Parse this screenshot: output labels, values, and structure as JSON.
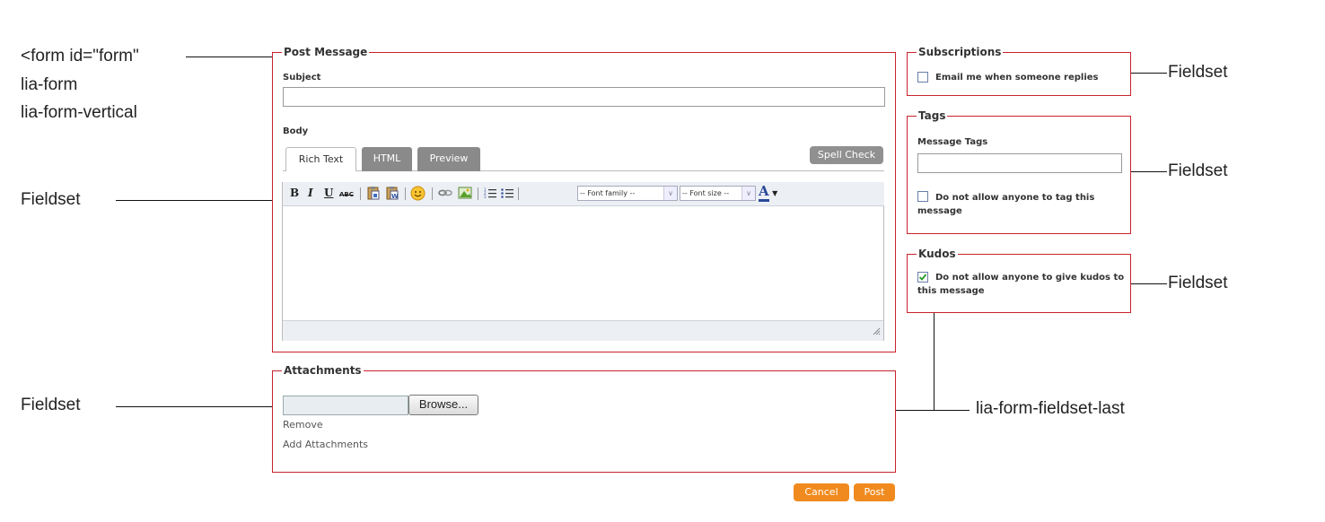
{
  "annotations": {
    "form_line1": "<form id=\"form\"",
    "form_line2": "lia-form",
    "form_line3": "lia-form-vertical",
    "fieldset_left_1": "Fieldset",
    "fieldset_left_2": "Fieldset",
    "fieldset_right_1": "Fieldset",
    "fieldset_right_2": "Fieldset",
    "fieldset_right_3": "Fieldset",
    "last_fieldset": "lia-form-fieldset-last"
  },
  "post_message": {
    "legend": "Post Message",
    "subject_label": "Subject",
    "subject_value": "",
    "body_label": "Body",
    "tabs": [
      {
        "label": "Rich Text",
        "active": true
      },
      {
        "label": "HTML",
        "active": false
      },
      {
        "label": "Preview",
        "active": false
      }
    ],
    "spell_check": "Spell Check",
    "toolbar": {
      "bold": "B",
      "italic": "I",
      "underline": "U",
      "strike": "ABC",
      "font_family": "-- Font family --",
      "font_size": "-- Font size --",
      "text_color": "A"
    }
  },
  "attachments": {
    "legend": "Attachments",
    "browse": "Browse...",
    "remove": "Remove",
    "add": "Add Attachments"
  },
  "actions": {
    "cancel": "Cancel",
    "post": "Post"
  },
  "subscriptions": {
    "legend": "Subscriptions",
    "email_label": "Email me when someone replies",
    "email_checked": false
  },
  "tags": {
    "legend": "Tags",
    "message_tags_label": "Message Tags",
    "tags_value": "",
    "no_tag_label": "Do not allow anyone to tag this message",
    "no_tag_checked": false
  },
  "kudos": {
    "legend": "Kudos",
    "no_kudos_label": "Do not allow anyone to give kudos to this message",
    "no_kudos_checked": true
  },
  "colors": {
    "fieldset_border": "#c8232c",
    "button_orange": "#f18a1e",
    "tab_gray": "#8a8a8a"
  }
}
